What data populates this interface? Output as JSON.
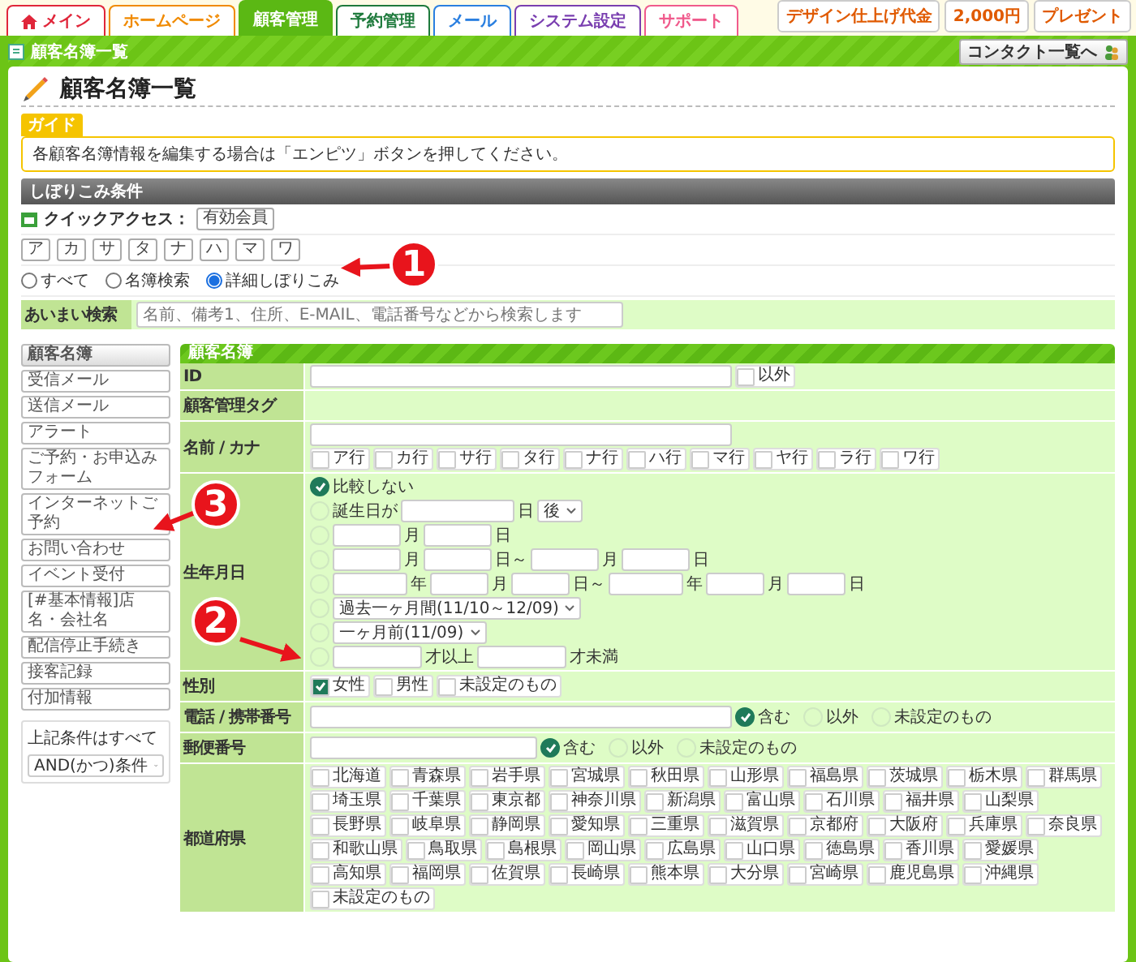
{
  "nav_tabs": [
    {
      "label": "メイン",
      "color": "#e0263a",
      "selected": false,
      "kind": "home"
    },
    {
      "label": "ホームページ",
      "color": "#f08a00",
      "selected": false,
      "kind": "plain"
    },
    {
      "label": "顧客管理",
      "color": "#5bb814",
      "selected": true,
      "kind": "plain"
    },
    {
      "label": "予約管理",
      "color": "#1e7a3c",
      "selected": false,
      "kind": "plain"
    },
    {
      "label": "メール",
      "color": "#2a7fe0",
      "selected": false,
      "kind": "plain"
    },
    {
      "label": "システム設定",
      "color": "#7a3fb0",
      "selected": false,
      "kind": "plain"
    },
    {
      "label": "サポート",
      "color": "#f05a8c",
      "selected": false,
      "kind": "plain"
    }
  ],
  "banners": [
    "デザイン仕上げ代金",
    "2,000円",
    "プレゼント"
  ],
  "breadcrumb": "顧客名簿一覧",
  "contact_button": "コンタクト一覧へ",
  "page_title": "顧客名簿一覧",
  "guide": {
    "tag": "ガイド",
    "text": "各顧客名簿情報を編集する場合は「エンピツ」ボタンを押してください。"
  },
  "filter": {
    "title": "しぼりこみ条件",
    "quick_access_label": "クイックアクセス：",
    "quick_access_button": "有効会員",
    "kana_buttons": [
      "ア",
      "カ",
      "サ",
      "タ",
      "ナ",
      "ハ",
      "マ",
      "ワ"
    ],
    "modes": [
      {
        "label": "すべて",
        "selected": false
      },
      {
        "label": "名簿検索",
        "selected": false
      },
      {
        "label": "詳細しぼりこみ",
        "selected": true
      }
    ],
    "fuzzy_label": "あいまい検索",
    "fuzzy_placeholder": "名前、備考1、住所、E-MAIL、電話番号などから検索します"
  },
  "sidebar": {
    "items": [
      {
        "label": "顧客名簿",
        "selected": true
      },
      {
        "label": "受信メール",
        "selected": false
      },
      {
        "label": "送信メール",
        "selected": false
      },
      {
        "label": "アラート",
        "selected": false
      },
      {
        "label": "ご予約・お申込みフォーム",
        "selected": false
      },
      {
        "label": "インターネットご予約",
        "selected": false
      },
      {
        "label": "お問い合わせ",
        "selected": false
      },
      {
        "label": "イベント受付",
        "selected": false
      },
      {
        "label": "[#基本情報]店名・会社名",
        "selected": false
      },
      {
        "label": "配信停止手続き",
        "selected": false
      },
      {
        "label": "接客記録",
        "selected": false
      },
      {
        "label": "付加情報",
        "selected": false
      }
    ],
    "condition_label": "上記条件はすべて",
    "condition_select": "AND(かつ)条件"
  },
  "form": {
    "title": "顧客名簿",
    "id_label": "ID",
    "id_except": {
      "label": "以外",
      "checked": false
    },
    "tag_label": "顧客管理タグ",
    "name_label": "名前 / カナ",
    "kana_rows": [
      {
        "label": "ア行",
        "checked": false
      },
      {
        "label": "カ行",
        "checked": false
      },
      {
        "label": "サ行",
        "checked": false
      },
      {
        "label": "タ行",
        "checked": false
      },
      {
        "label": "ナ行",
        "checked": false
      },
      {
        "label": "ハ行",
        "checked": false
      },
      {
        "label": "マ行",
        "checked": false
      },
      {
        "label": "ヤ行",
        "checked": false
      },
      {
        "label": "ラ行",
        "checked": false
      },
      {
        "label": "ワ行",
        "checked": false
      }
    ],
    "birth_label": "生年月日",
    "birth_options": [
      {
        "kind": "none",
        "selected": true,
        "texts": [
          "比較しない"
        ]
      },
      {
        "kind": "days",
        "selected": false,
        "texts": [
          "誕生日が",
          "日"
        ],
        "select": "後"
      },
      {
        "kind": "monthday",
        "selected": false,
        "texts": [
          "月",
          "日"
        ]
      },
      {
        "kind": "monthday_range",
        "selected": false,
        "texts": [
          "月",
          "日～",
          "月",
          "日"
        ]
      },
      {
        "kind": "date_range",
        "selected": false,
        "texts": [
          "年",
          "月",
          "日～",
          "年",
          "月",
          "日"
        ]
      },
      {
        "kind": "select",
        "selected": false,
        "select": "過去一ヶ月間(11/10～12/09)"
      },
      {
        "kind": "select",
        "selected": false,
        "select": "一ヶ月前(11/09)"
      },
      {
        "kind": "age",
        "selected": false,
        "texts": [
          "才以上",
          "才未満"
        ]
      }
    ],
    "gender_label": "性別",
    "genders": [
      {
        "label": "女性",
        "checked": true
      },
      {
        "label": "男性",
        "checked": false
      },
      {
        "label": "未設定のもの",
        "checked": false
      }
    ],
    "phone_label": "電話 / 携帯番号",
    "phone_modes": [
      {
        "label": "含む",
        "selected": true
      },
      {
        "label": "以外",
        "selected": false
      },
      {
        "label": "未設定のもの",
        "selected": false
      }
    ],
    "postal_label": "郵便番号",
    "postal_modes": [
      {
        "label": "含む",
        "selected": true
      },
      {
        "label": "以外",
        "selected": false
      },
      {
        "label": "未設定のもの",
        "selected": false
      }
    ],
    "pref_label": "都道府県",
    "prefectures": [
      {
        "label": "北海道",
        "checked": false
      },
      {
        "label": "青森県",
        "checked": false
      },
      {
        "label": "岩手県",
        "checked": false
      },
      {
        "label": "宮城県",
        "checked": false
      },
      {
        "label": "秋田県",
        "checked": false
      },
      {
        "label": "山形県",
        "checked": false
      },
      {
        "label": "福島県",
        "checked": false
      },
      {
        "label": "茨城県",
        "checked": false
      },
      {
        "label": "栃木県",
        "checked": false
      },
      {
        "label": "群馬県",
        "checked": false
      },
      {
        "label": "埼玉県",
        "checked": false
      },
      {
        "label": "千葉県",
        "checked": false
      },
      {
        "label": "東京都",
        "checked": false
      },
      {
        "label": "神奈川県",
        "checked": false
      },
      {
        "label": "新潟県",
        "checked": false
      },
      {
        "label": "富山県",
        "checked": false
      },
      {
        "label": "石川県",
        "checked": false
      },
      {
        "label": "福井県",
        "checked": false
      },
      {
        "label": "山梨県",
        "checked": false
      },
      {
        "label": "長野県",
        "checked": false
      },
      {
        "label": "岐阜県",
        "checked": false
      },
      {
        "label": "静岡県",
        "checked": false
      },
      {
        "label": "愛知県",
        "checked": false
      },
      {
        "label": "三重県",
        "checked": false
      },
      {
        "label": "滋賀県",
        "checked": false
      },
      {
        "label": "京都府",
        "checked": false
      },
      {
        "label": "大阪府",
        "checked": false
      },
      {
        "label": "兵庫県",
        "checked": false
      },
      {
        "label": "奈良県",
        "checked": false
      },
      {
        "label": "和歌山県",
        "checked": false
      },
      {
        "label": "鳥取県",
        "checked": false
      },
      {
        "label": "島根県",
        "checked": false
      },
      {
        "label": "岡山県",
        "checked": false
      },
      {
        "label": "広島県",
        "checked": false
      },
      {
        "label": "山口県",
        "checked": false
      },
      {
        "label": "徳島県",
        "checked": false
      },
      {
        "label": "香川県",
        "checked": false
      },
      {
        "label": "愛媛県",
        "checked": false
      },
      {
        "label": "高知県",
        "checked": false
      },
      {
        "label": "福岡県",
        "checked": false
      },
      {
        "label": "佐賀県",
        "checked": false
      },
      {
        "label": "長崎県",
        "checked": false
      },
      {
        "label": "熊本県",
        "checked": false
      },
      {
        "label": "大分県",
        "checked": false
      },
      {
        "label": "宮崎県",
        "checked": false
      },
      {
        "label": "鹿児島県",
        "checked": false
      },
      {
        "label": "沖縄県",
        "checked": false
      },
      {
        "label": "未設定のもの",
        "checked": false
      }
    ]
  },
  "annotations": [
    {
      "number": "1"
    },
    {
      "number": "2"
    },
    {
      "number": "3"
    }
  ]
}
